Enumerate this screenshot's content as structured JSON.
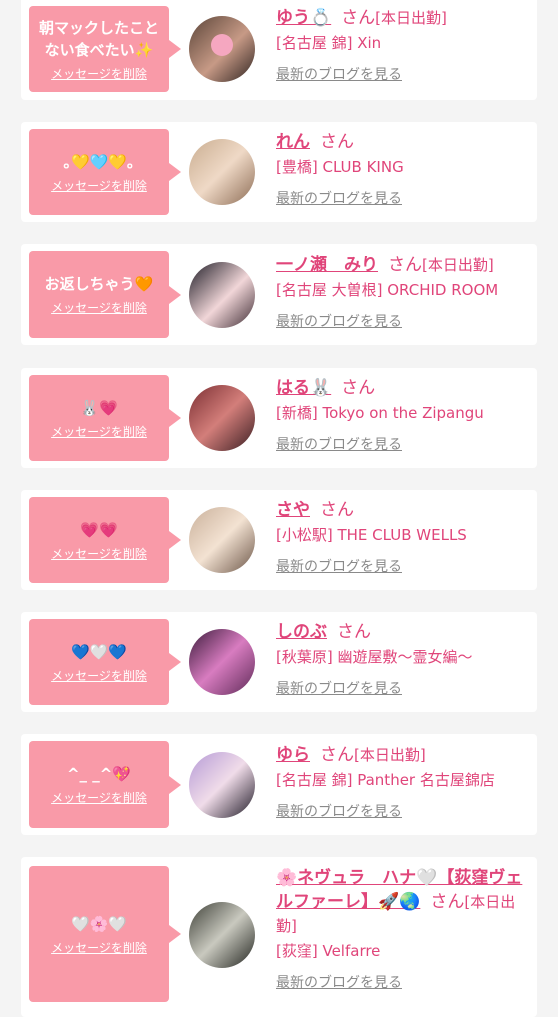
{
  "delete_label": "メッセージを削除",
  "san_label": "さん",
  "blog_label": "最新のブログを見る",
  "entries": [
    {
      "message": "朝マックしたことない食べたい✨",
      "name": "ゆう💍",
      "status": "[本日出勤]",
      "shop": "[名古屋 錦] Xin"
    },
    {
      "message": "｡💛🩵💛｡",
      "name": "れん",
      "status": "",
      "shop": "[豊橋] CLUB KING"
    },
    {
      "message": "お返しちゃう🧡",
      "name": "一ノ瀬　みり",
      "status": "[本日出勤]",
      "shop": "[名古屋 大曽根] ORCHID ROOM"
    },
    {
      "message": "🐰💗",
      "name": "はる🐰",
      "status": "",
      "shop": "[新橋] Tokyo on the Zipangu"
    },
    {
      "message": "💗💗",
      "name": "さや",
      "status": "",
      "shop": "[小松駅] THE CLUB WELLS"
    },
    {
      "message": "💙🤍💙",
      "name": "しのぶ",
      "status": "",
      "shop": "[秋葉原] 幽遊屋敷〜霊女編〜"
    },
    {
      "message": "^_ _^💖",
      "name": "ゆら",
      "status": "[本日出勤]",
      "shop": "[名古屋 錦] Panther 名古屋錦店"
    },
    {
      "message": "🤍🌸🤍",
      "name": "🌸ネヴュラ　ハナ🤍【荻窪ヴェルファーレ】🚀🌏",
      "status": "[本日出勤]",
      "shop": "[荻窪] Velfarre"
    }
  ]
}
